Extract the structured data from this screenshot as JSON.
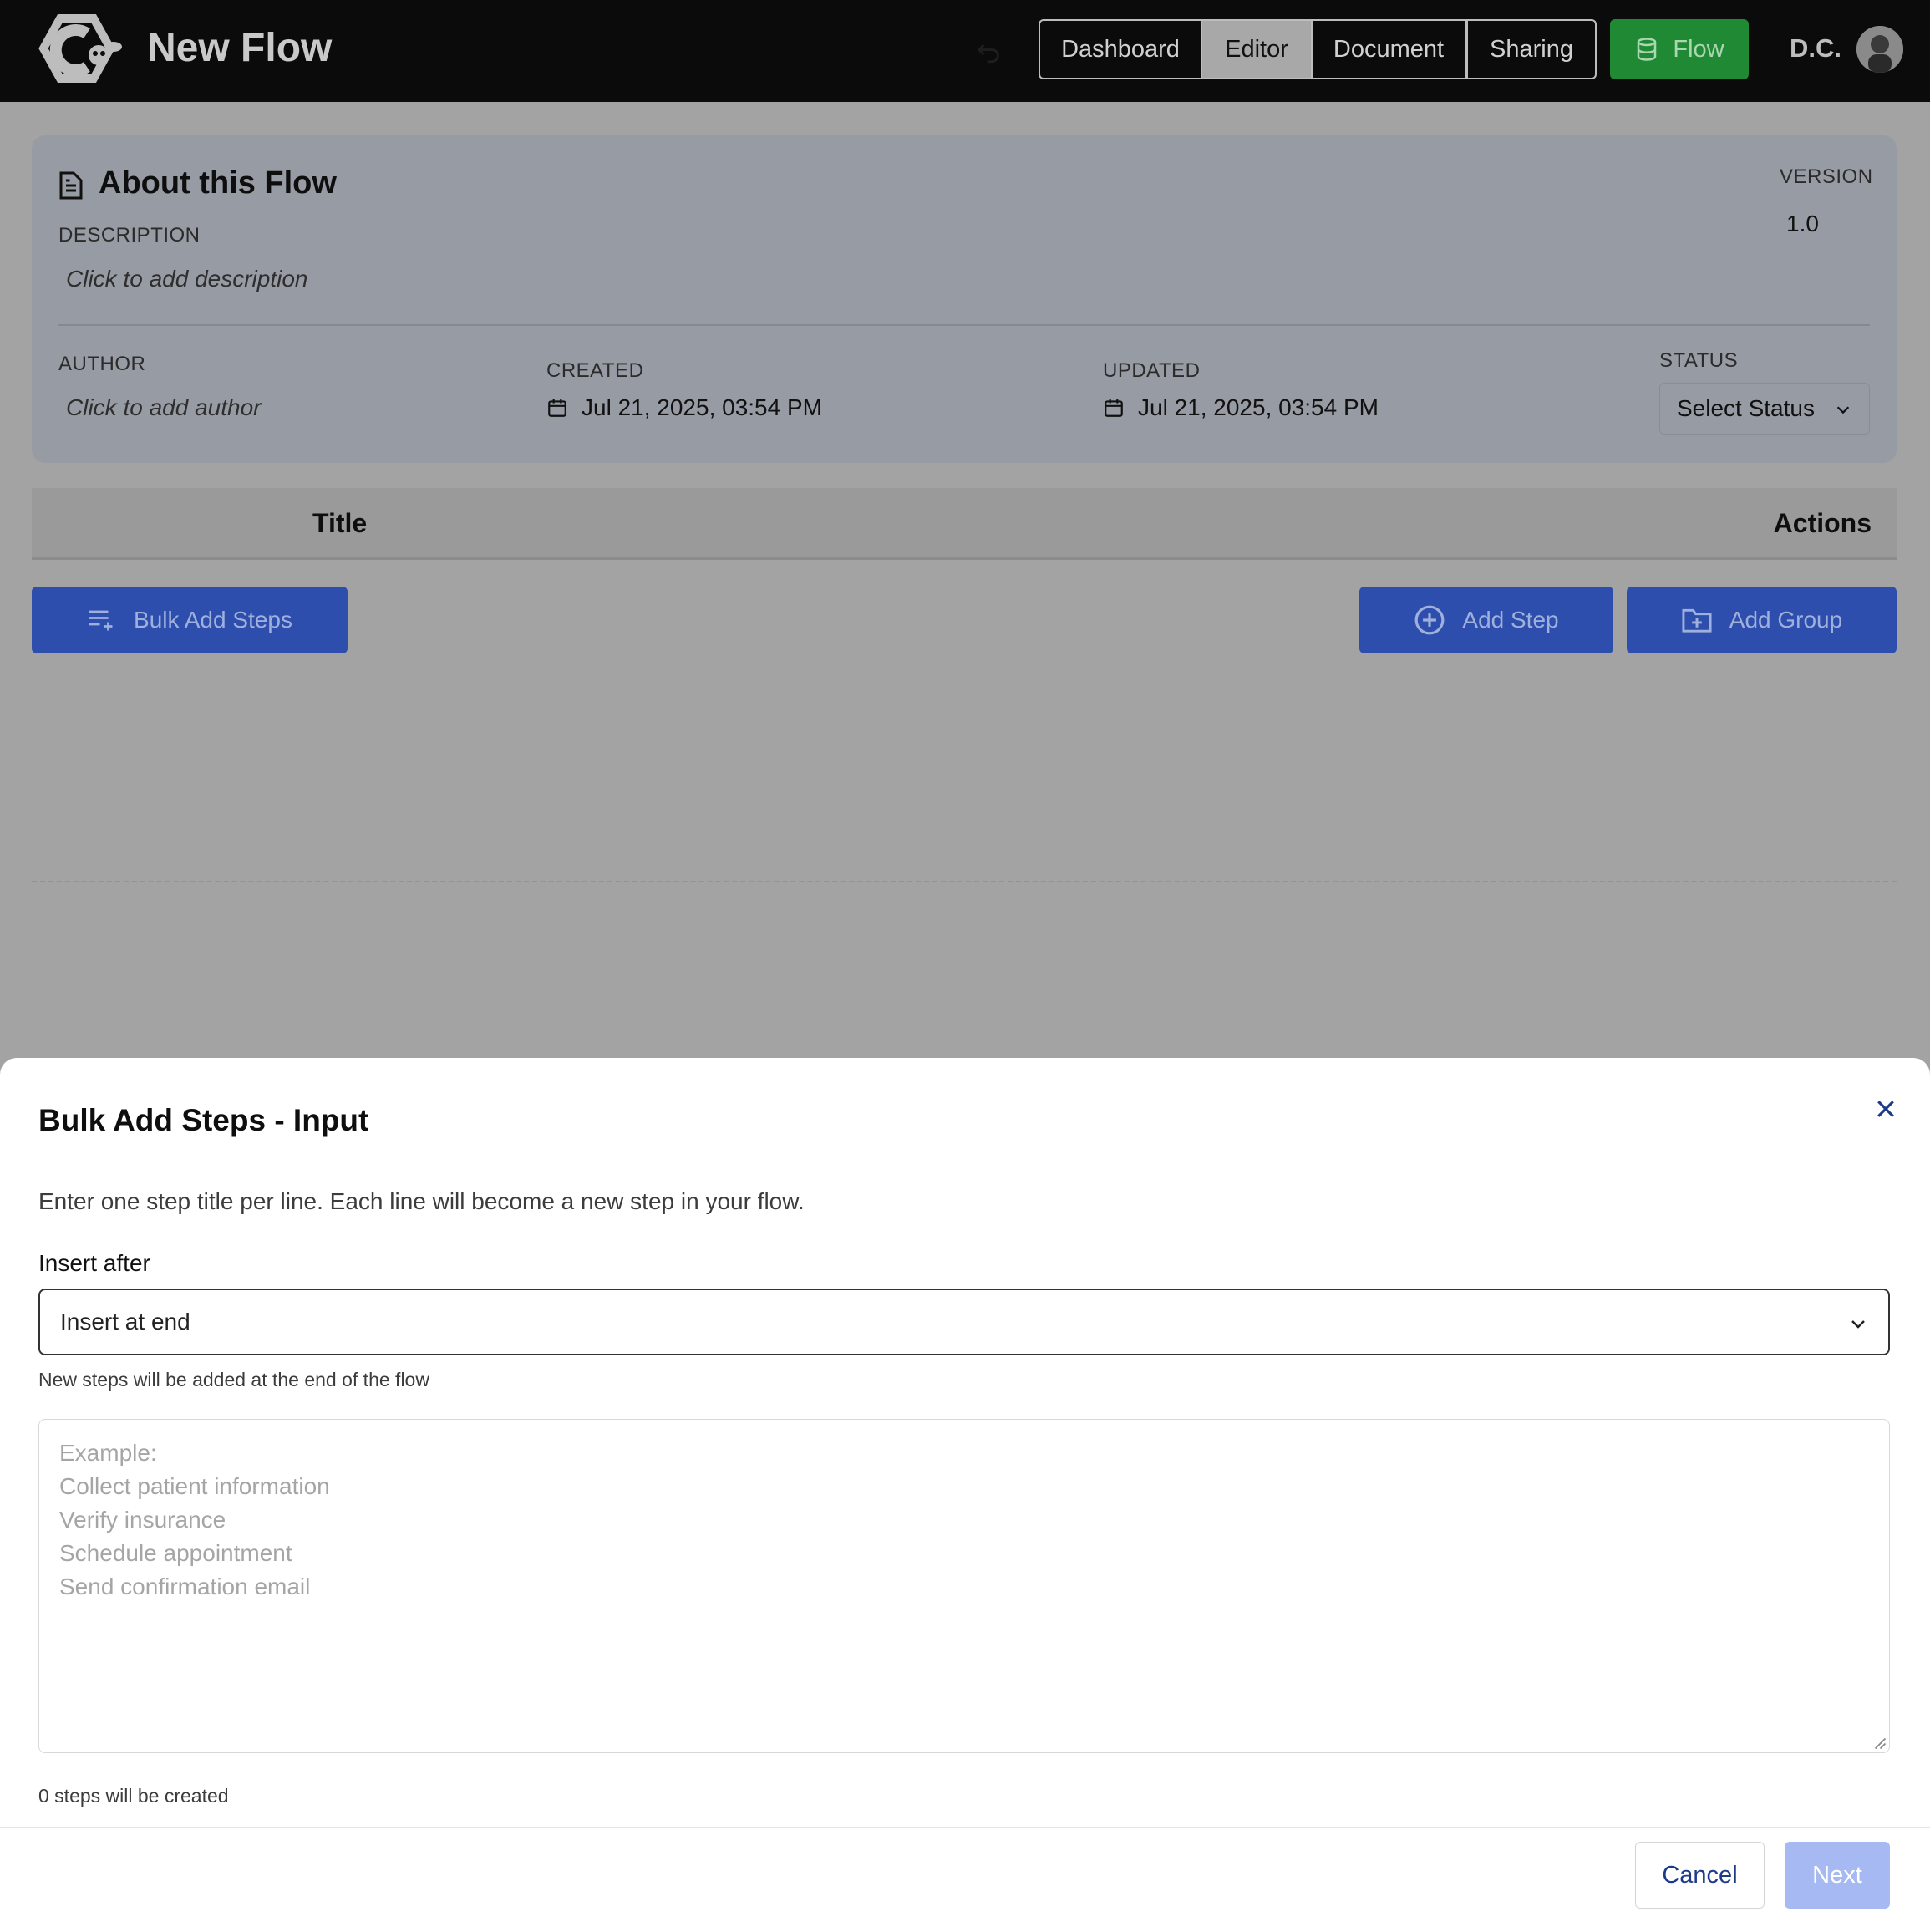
{
  "header": {
    "app_title": "New Flow",
    "tabs": [
      {
        "label": "Dashboard",
        "active": false
      },
      {
        "label": "Editor",
        "active": true
      },
      {
        "label": "Document",
        "active": false
      },
      {
        "label": "Sharing",
        "active": false
      }
    ],
    "flow_button": "Flow",
    "flow_icon": "database-icon",
    "user_initials": "D.C.",
    "accent_green": "#1f8a33"
  },
  "about": {
    "title": "About this Flow",
    "description_label": "DESCRIPTION",
    "description_placeholder": "Click to add description",
    "version_label": "VERSION",
    "version_value": "1.0",
    "author_label": "AUTHOR",
    "author_placeholder": "Click to add author",
    "created_label": "CREATED",
    "created_value": "Jul 21, 2025, 03:54 PM",
    "updated_label": "UPDATED",
    "updated_value": "Jul 21, 2025, 03:54 PM",
    "status_label": "STATUS",
    "status_value": "Select Status"
  },
  "table": {
    "col_title": "Title",
    "col_actions": "Actions"
  },
  "toolbar": {
    "bulk_add": "Bulk Add Steps",
    "add_step": "Add Step",
    "add_group": "Add Group",
    "accent_blue": "#2e4ead"
  },
  "modal": {
    "title": "Bulk Add Steps - Input",
    "description": "Enter one step title per line. Each line will become a new step in your flow.",
    "insert_label": "Insert after",
    "insert_value": "Insert at end",
    "help_text": "New steps will be added at the end of the flow",
    "textarea_placeholder": "Example:\nCollect patient information\nVerify insurance\nSchedule appointment\nSend confirmation email",
    "textarea_value": "",
    "count_text": "0 steps will be created",
    "cancel": "Cancel",
    "next": "Next"
  }
}
